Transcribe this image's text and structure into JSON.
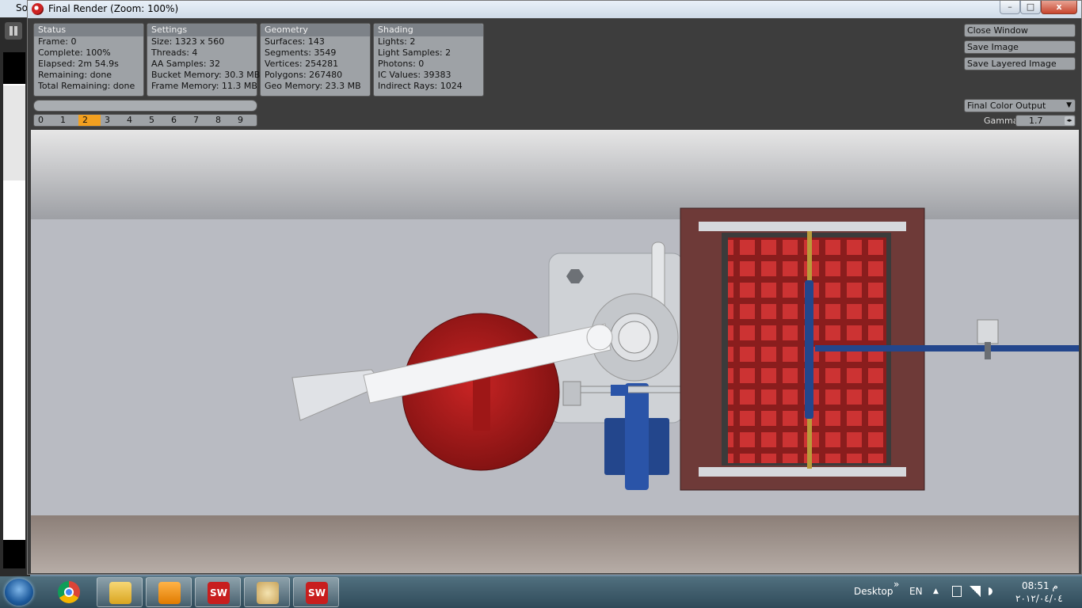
{
  "background_app": {
    "title": "So"
  },
  "window": {
    "title": "Final Render (Zoom: 100%)",
    "buttons": {
      "minimize": "–",
      "maximize": "□",
      "close": "x"
    }
  },
  "panels": {
    "status": {
      "header": "Status",
      "lines": [
        "Frame: 0",
        "Complete: 100%",
        "Elapsed: 2m 54.9s",
        "Remaining: done",
        "Total Remaining: done"
      ]
    },
    "settings": {
      "header": "Settings",
      "lines": [
        "Size: 1323 x 560",
        "Threads: 4",
        "AA Samples: 32",
        "Bucket Memory: 30.3 MB",
        "Frame Memory: 11.3 MB"
      ]
    },
    "geometry": {
      "header": "Geometry",
      "lines": [
        "Surfaces: 143",
        "Segments: 3549",
        "Vertices: 254281",
        "Polygons: 267480",
        "Geo Memory: 23.3 MB"
      ]
    },
    "shading": {
      "header": "Shading",
      "lines": [
        "Lights: 2",
        "Light Samples: 2",
        "Photons: 0",
        "IC Values: 39383",
        "Indirect Rays: 1024"
      ]
    }
  },
  "progress": {
    "fraction": 1.0
  },
  "buffers": {
    "items": [
      "0",
      "1",
      "2",
      "3",
      "4",
      "5",
      "6",
      "7",
      "8",
      "9"
    ],
    "selected": "2"
  },
  "actions": {
    "close_window": "Close Window",
    "save_image": "Save Image",
    "save_layered": "Save Layered Image"
  },
  "output": {
    "selected": "Final Color Output",
    "arrow": "▼"
  },
  "gamma": {
    "label": "Gamma",
    "value": "1.7",
    "spin": "◂▸"
  },
  "colors": {
    "accent_selected": "#f2a020",
    "panel": "#9ea2a6",
    "panel_header": "#7d8288"
  },
  "taskbar": {
    "icons": [
      "windows-start-icon",
      "chrome-icon",
      "explorer-icon",
      "media-player-icon",
      "solidworks-icon",
      "paint-icon",
      "solidworks-icon"
    ],
    "sw1": "SW",
    "sw2": "SW",
    "desktop": "Desktop",
    "chevron": "»",
    "lang": "EN",
    "tray_up": "▲",
    "clock_time": "08:51 م",
    "clock_date": "٢٠١٢/٠٤/٠٤"
  }
}
